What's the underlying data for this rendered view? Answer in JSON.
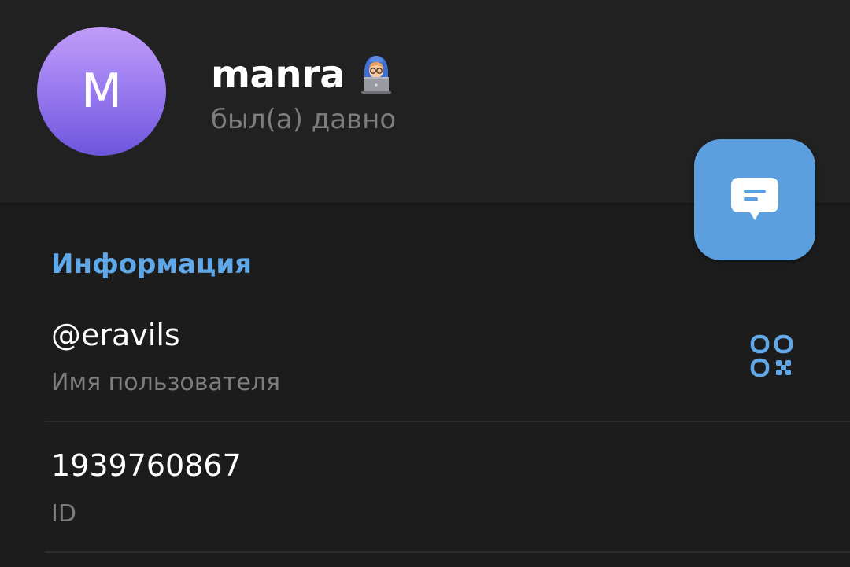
{
  "profile": {
    "avatar_initial": "M",
    "name": "manra",
    "name_emoji_icon": "hacker-laptop-emoji-icon",
    "status": "был(а) давно"
  },
  "actions": {
    "message_icon": "message-bubble-icon"
  },
  "info_section": {
    "title": "Информация",
    "username": {
      "value": "@eravils",
      "label": "Имя пользователя",
      "action_icon": "qr-code-icon"
    },
    "id": {
      "value": "1939760867",
      "label": "ID"
    }
  },
  "colors": {
    "background": "#1c1c1d",
    "header_background": "#212121",
    "accent": "#5fa8e9",
    "fab": "#5b9fdf",
    "avatar_gradient_top": "#c09cf7",
    "avatar_gradient_bottom": "#6d55dd",
    "secondary_text": "#7d7d7d"
  }
}
